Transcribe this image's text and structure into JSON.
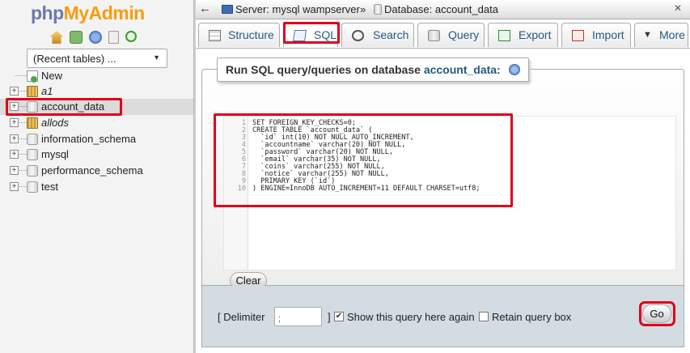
{
  "logo": {
    "part1": "php",
    "part2": "MyAdmin"
  },
  "nav": {
    "recent_tables": "(Recent tables) ...",
    "tree": [
      {
        "label": "New",
        "italic": false
      },
      {
        "label": "a1",
        "italic": true
      },
      {
        "label": "account_data",
        "italic": false
      },
      {
        "label": "allods",
        "italic": true
      },
      {
        "label": "information_schema",
        "italic": false
      },
      {
        "label": "mysql",
        "italic": false
      },
      {
        "label": "performance_schema",
        "italic": false
      },
      {
        "label": "test",
        "italic": false
      }
    ]
  },
  "breadcrumb": {
    "back": "←",
    "server": "Server: mysql wampserver",
    "separator": "»",
    "database": "Database: account_data"
  },
  "tabs": [
    {
      "label": "Structure"
    },
    {
      "label": "SQL"
    },
    {
      "label": "Search"
    },
    {
      "label": "Query"
    },
    {
      "label": "Export"
    },
    {
      "label": "Import"
    },
    {
      "label": "More"
    }
  ],
  "sql_panel": {
    "title": "Run SQL query/queries on database",
    "database": "account_data:",
    "code_lines": [
      {
        "n": "1",
        "text": "SET FOREIGN_KEY_CHECKS=0;"
      },
      {
        "n": "2",
        "text": "CREATE TABLE `account_data` ("
      },
      {
        "n": "3",
        "text": "  `id` int(10) NOT NULL AUTO_INCREMENT,"
      },
      {
        "n": "4",
        "text": "  `accountname` varchar(20) NOT NULL,"
      },
      {
        "n": "5",
        "text": "  `password` varchar(20) NOT NULL,"
      },
      {
        "n": "6",
        "text": "  `email` varchar(35) NOT NULL,"
      },
      {
        "n": "7",
        "text": "  `coins` varchar(255) NOT NULL,"
      },
      {
        "n": "8",
        "text": "  `notice` varchar(255) NOT NULL,"
      },
      {
        "n": "9",
        "text": "  PRIMARY KEY (`id`)"
      },
      {
        "n": "10",
        "text": ") ENGINE=InnoDB AUTO_INCREMENT=11 DEFAULT CHARSET=utf8;"
      }
    ],
    "clear_label": "Clear"
  },
  "footer": {
    "delimiter_label": "[ Delimiter",
    "delimiter_value": ";",
    "bracket_close": "]",
    "show_query_label": "Show this query here again",
    "show_query_checked": true,
    "retain_label": "Retain query box",
    "retain_checked": false,
    "go_label": "Go"
  },
  "colors": {
    "highlight": "#e0001b",
    "link": "#235a81",
    "logo_php": "#6c78af",
    "logo_myadmin": "#f89c0e"
  }
}
